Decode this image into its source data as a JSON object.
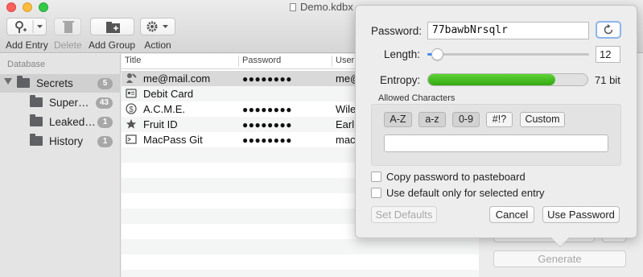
{
  "window": {
    "title": "Demo.kdbx"
  },
  "toolbar": {
    "add_entry": "Add Entry",
    "delete": "Delete",
    "add_group": "Add Group",
    "action": "Action"
  },
  "sidebar": {
    "header": "Database",
    "items": [
      {
        "label": "Secrets",
        "count": "5"
      },
      {
        "label": "Super…",
        "count": "43"
      },
      {
        "label": "Leaked…",
        "count": "1"
      },
      {
        "label": "History",
        "count": "1"
      }
    ]
  },
  "table": {
    "columns": [
      "Title",
      "Password",
      "User"
    ],
    "rows": [
      {
        "title": "me@mail.com",
        "password": "●●●●●●●●",
        "user": "me@",
        "icon": "key-person-icon"
      },
      {
        "title": "Debit Card",
        "password": "",
        "user": "",
        "icon": "card-icon"
      },
      {
        "title": "A.C.M.E.",
        "password": "●●●●●●●●",
        "user": "Wile",
        "icon": "dollar-icon"
      },
      {
        "title": "Fruit ID",
        "password": "●●●●●●●●",
        "user": "Earl",
        "icon": "star-icon"
      },
      {
        "title": "MacPass Git",
        "password": "●●●●●●●●",
        "user": "mac",
        "icon": "terminal-icon"
      }
    ]
  },
  "inspector": {
    "generate_label": "Generate"
  },
  "generator": {
    "password_label": "Password:",
    "password_value": "77bawbNrsqlr",
    "length_label": "Length:",
    "length_value": "12",
    "length_fraction": 0.04,
    "entropy_label": "Entropy:",
    "entropy_value": "71 bit",
    "entropy_fraction": 0.8,
    "allowed_title": "Allowed Characters",
    "charsets": [
      {
        "label": "A-Z",
        "on": true
      },
      {
        "label": "a-z",
        "on": true
      },
      {
        "label": "0-9",
        "on": true
      },
      {
        "label": "#!?",
        "on": false
      },
      {
        "label": "Custom",
        "on": false
      }
    ],
    "custom_value": "",
    "copy_label": "Copy password to pasteboard",
    "copy_checked": false,
    "default_label": "Use default only for selected entry",
    "default_checked": false,
    "set_defaults": "Set Defaults",
    "cancel": "Cancel",
    "use_password": "Use Password"
  },
  "colors": {
    "accent": "#3d8cf7",
    "entropy": "#3dbb1c",
    "badge": "#a7a7a7"
  }
}
